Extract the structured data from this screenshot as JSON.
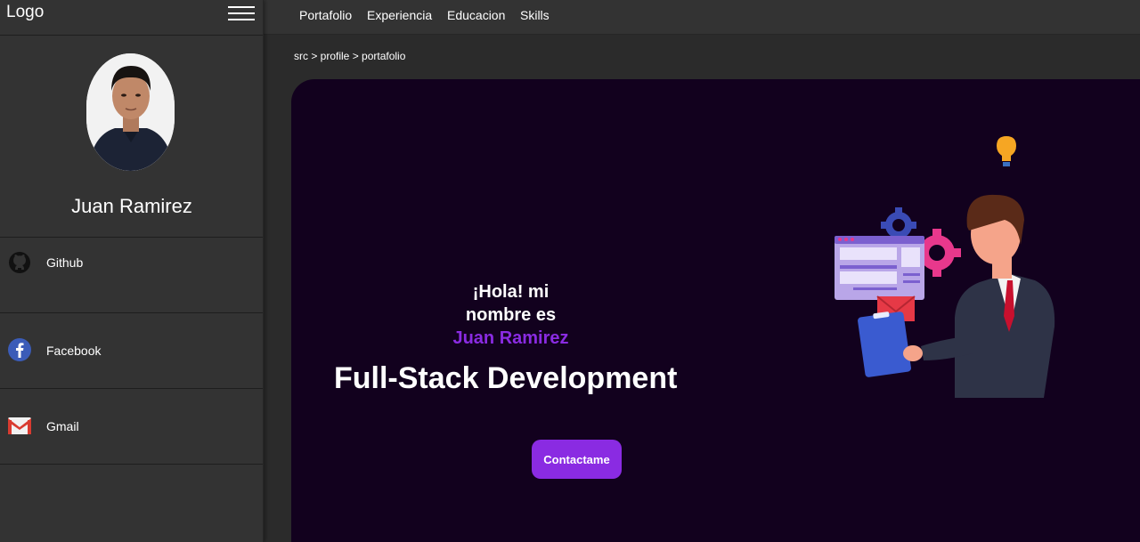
{
  "header": {
    "logo": "Logo",
    "nav": [
      "Portafolio",
      "Experiencia",
      "Educacion",
      "Skills"
    ]
  },
  "sidebar": {
    "name": "Juan Ramirez",
    "social": [
      {
        "label": "Github",
        "icon": "github-icon"
      },
      {
        "label": "Facebook",
        "icon": "facebook-icon"
      },
      {
        "label": "Gmail",
        "icon": "gmail-icon"
      }
    ]
  },
  "breadcrumb": "src > profile > portafolio",
  "hero": {
    "greeting_line1": "¡Hola! mi",
    "greeting_line2": "nombre es",
    "name": "Juan Ramirez",
    "role": "Full-Stack Development",
    "cta_label": "Contactame"
  },
  "colors": {
    "accent": "#8a2be2",
    "hero_bg": "#12011e",
    "panel_bg": "#333333"
  }
}
